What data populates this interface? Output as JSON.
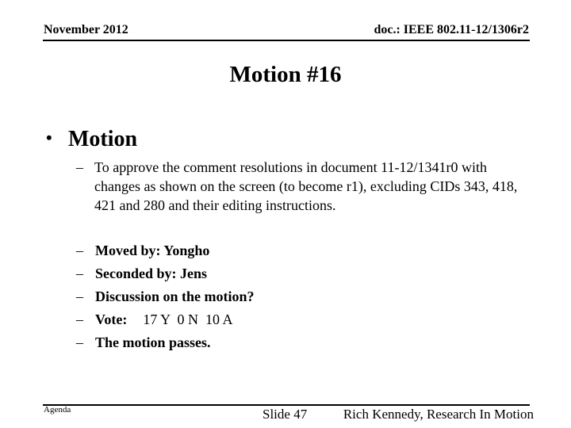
{
  "header": {
    "date": "November 2012",
    "doc_id": "doc.: IEEE 802.11-12/1306r2"
  },
  "title": "Motion #16",
  "bullet": {
    "symbol": "•",
    "label": "Motion"
  },
  "motion_text": {
    "dash": "–",
    "text": "To approve the comment resolutions in document 11-12/1341r0 with changes as shown on the screen (to become r1), excluding CIDs 343, 418, 421 and 280 and their editing instructions."
  },
  "items": [
    {
      "dash": "–",
      "label": "Moved by: Yongho"
    },
    {
      "dash": "–",
      "label": "Seconded by: Jens"
    },
    {
      "dash": "–",
      "label": "Discussion on the motion?"
    },
    {
      "dash": "–",
      "label": "Vote:",
      "value": "17 Y  0 N  10 A"
    },
    {
      "dash": "–",
      "label": "The motion passes."
    }
  ],
  "vote": {
    "yes": 17,
    "no": 0,
    "abstain": 10
  },
  "footer": {
    "left": "Agenda",
    "slide": "Slide 47",
    "author": "Rich Kennedy, Research In Motion"
  }
}
